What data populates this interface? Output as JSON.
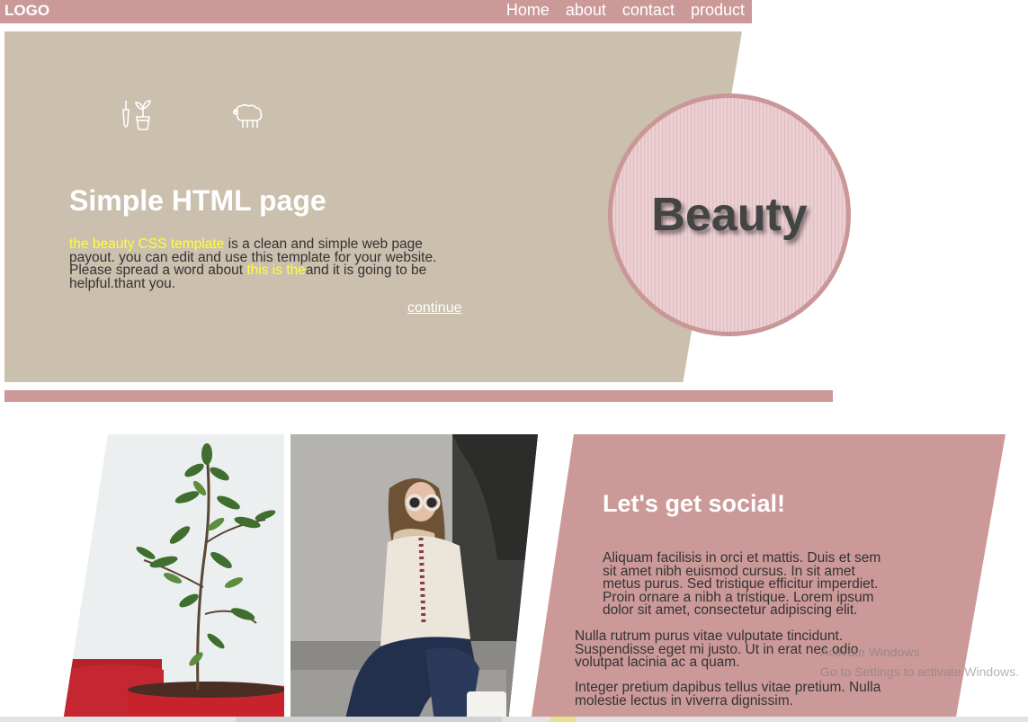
{
  "header": {
    "logo": "LOGO",
    "nav": [
      "Home",
      "about",
      "contact",
      "product"
    ]
  },
  "hero": {
    "icons": [
      "plant-tools-icon",
      "sheep-icon"
    ],
    "title": "Simple HTML page",
    "text": {
      "highlight1": "the beauty CSS template",
      "part1": " is a clean and simple web page payout. you can edit and use this template for your website. Please spread a word about ",
      "highlight2": "this is the",
      "part2": "and it is going to be helpful.thant you."
    },
    "continue_label": "continue"
  },
  "badge": {
    "label": "Beauty"
  },
  "gallery": {
    "photos": [
      "potted-plant-photo",
      "woman-sitting-photo"
    ]
  },
  "social": {
    "title": "Let's get social!",
    "para1": "Aliquam facilisis in orci et mattis. Duis et sem sit amet nibh euismod cursus. In sit amet metus purus. Sed tristique efficitur imperdiet. Proin ornare a nibh a tristique. Lorem ipsum dolor sit amet, consectetur adipiscing elit.",
    "para2": "Nulla rutrum purus vitae vulputate tincidunt. Suspendisse eget mi justo. Ut in erat nec odio volutpat lacinia ac a quam.",
    "para3": "Integer pretium dapibus tellus vitae pretium. Nulla molestie lectus in viverra dignissim."
  },
  "watermark": {
    "line1": "Activate Windows",
    "line2": "Go to Settings to activate Windows."
  },
  "colors": {
    "accent": "#cc9999",
    "hero_bg": "#cbbfad",
    "highlight": "#ffff33",
    "badge_border": "#c99797"
  }
}
